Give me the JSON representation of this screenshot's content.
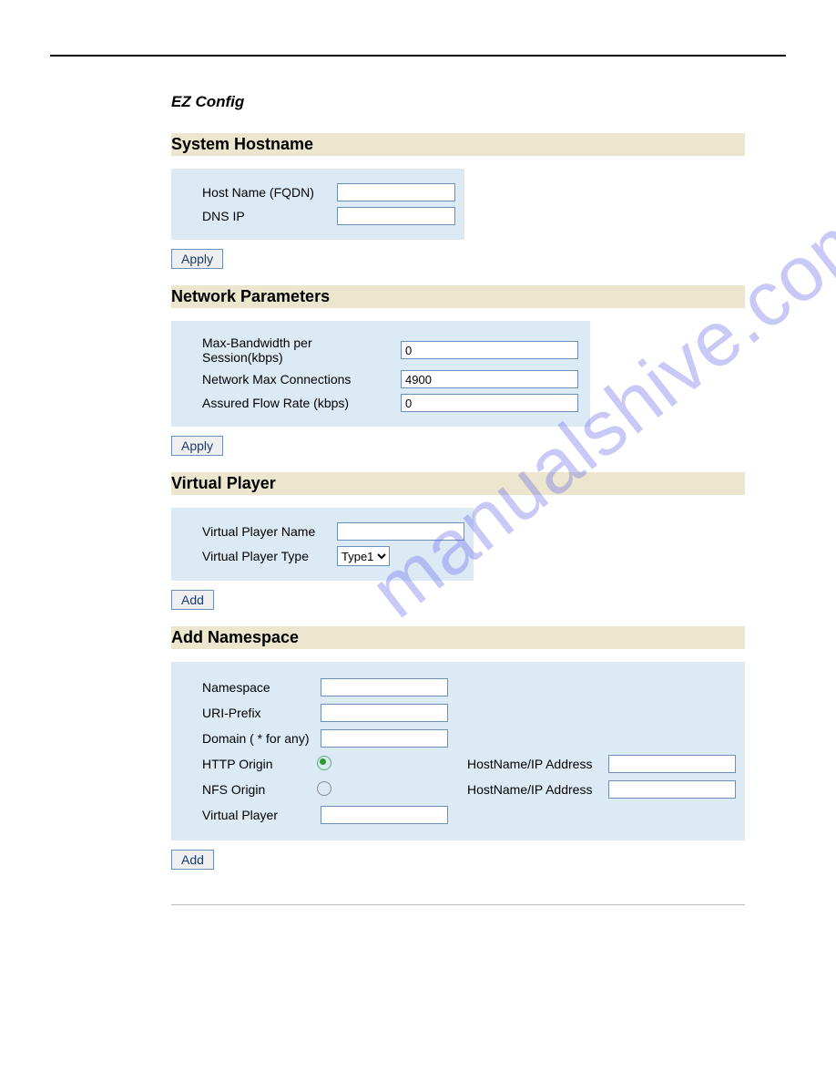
{
  "page_title": "EZ Config",
  "watermark": "manualshive.com",
  "sections": {
    "hostname": {
      "heading": "System Hostname",
      "host_label": "Host Name (FQDN)",
      "host_value": "",
      "dns_label": "DNS IP",
      "dns_value": "",
      "apply": "Apply"
    },
    "network": {
      "heading": "Network Parameters",
      "bw_label": "Max-Bandwidth per Session(kbps)",
      "bw_value": "0",
      "conn_label": "Network Max Connections",
      "conn_value": "4900",
      "afr_label": "Assured Flow Rate (kbps)",
      "afr_value": "0",
      "apply": "Apply"
    },
    "vplayer": {
      "heading": "Virtual Player",
      "name_label": "Virtual Player Name",
      "name_value": "",
      "type_label": "Virtual Player Type",
      "type_value": "Type1",
      "add": "Add"
    },
    "namespace": {
      "heading": "Add Namespace",
      "ns_label": "Namespace",
      "ns_value": "",
      "uri_label": "URI-Prefix",
      "uri_value": "",
      "domain_label": "Domain ( * for any)",
      "domain_value": "",
      "http_label": "HTTP Origin",
      "nfs_label": "NFS Origin",
      "hostip_label": "HostName/IP Address",
      "http_host_value": "",
      "nfs_host_value": "",
      "vp_label": "Virtual Player",
      "vp_value": "",
      "add": "Add"
    }
  }
}
